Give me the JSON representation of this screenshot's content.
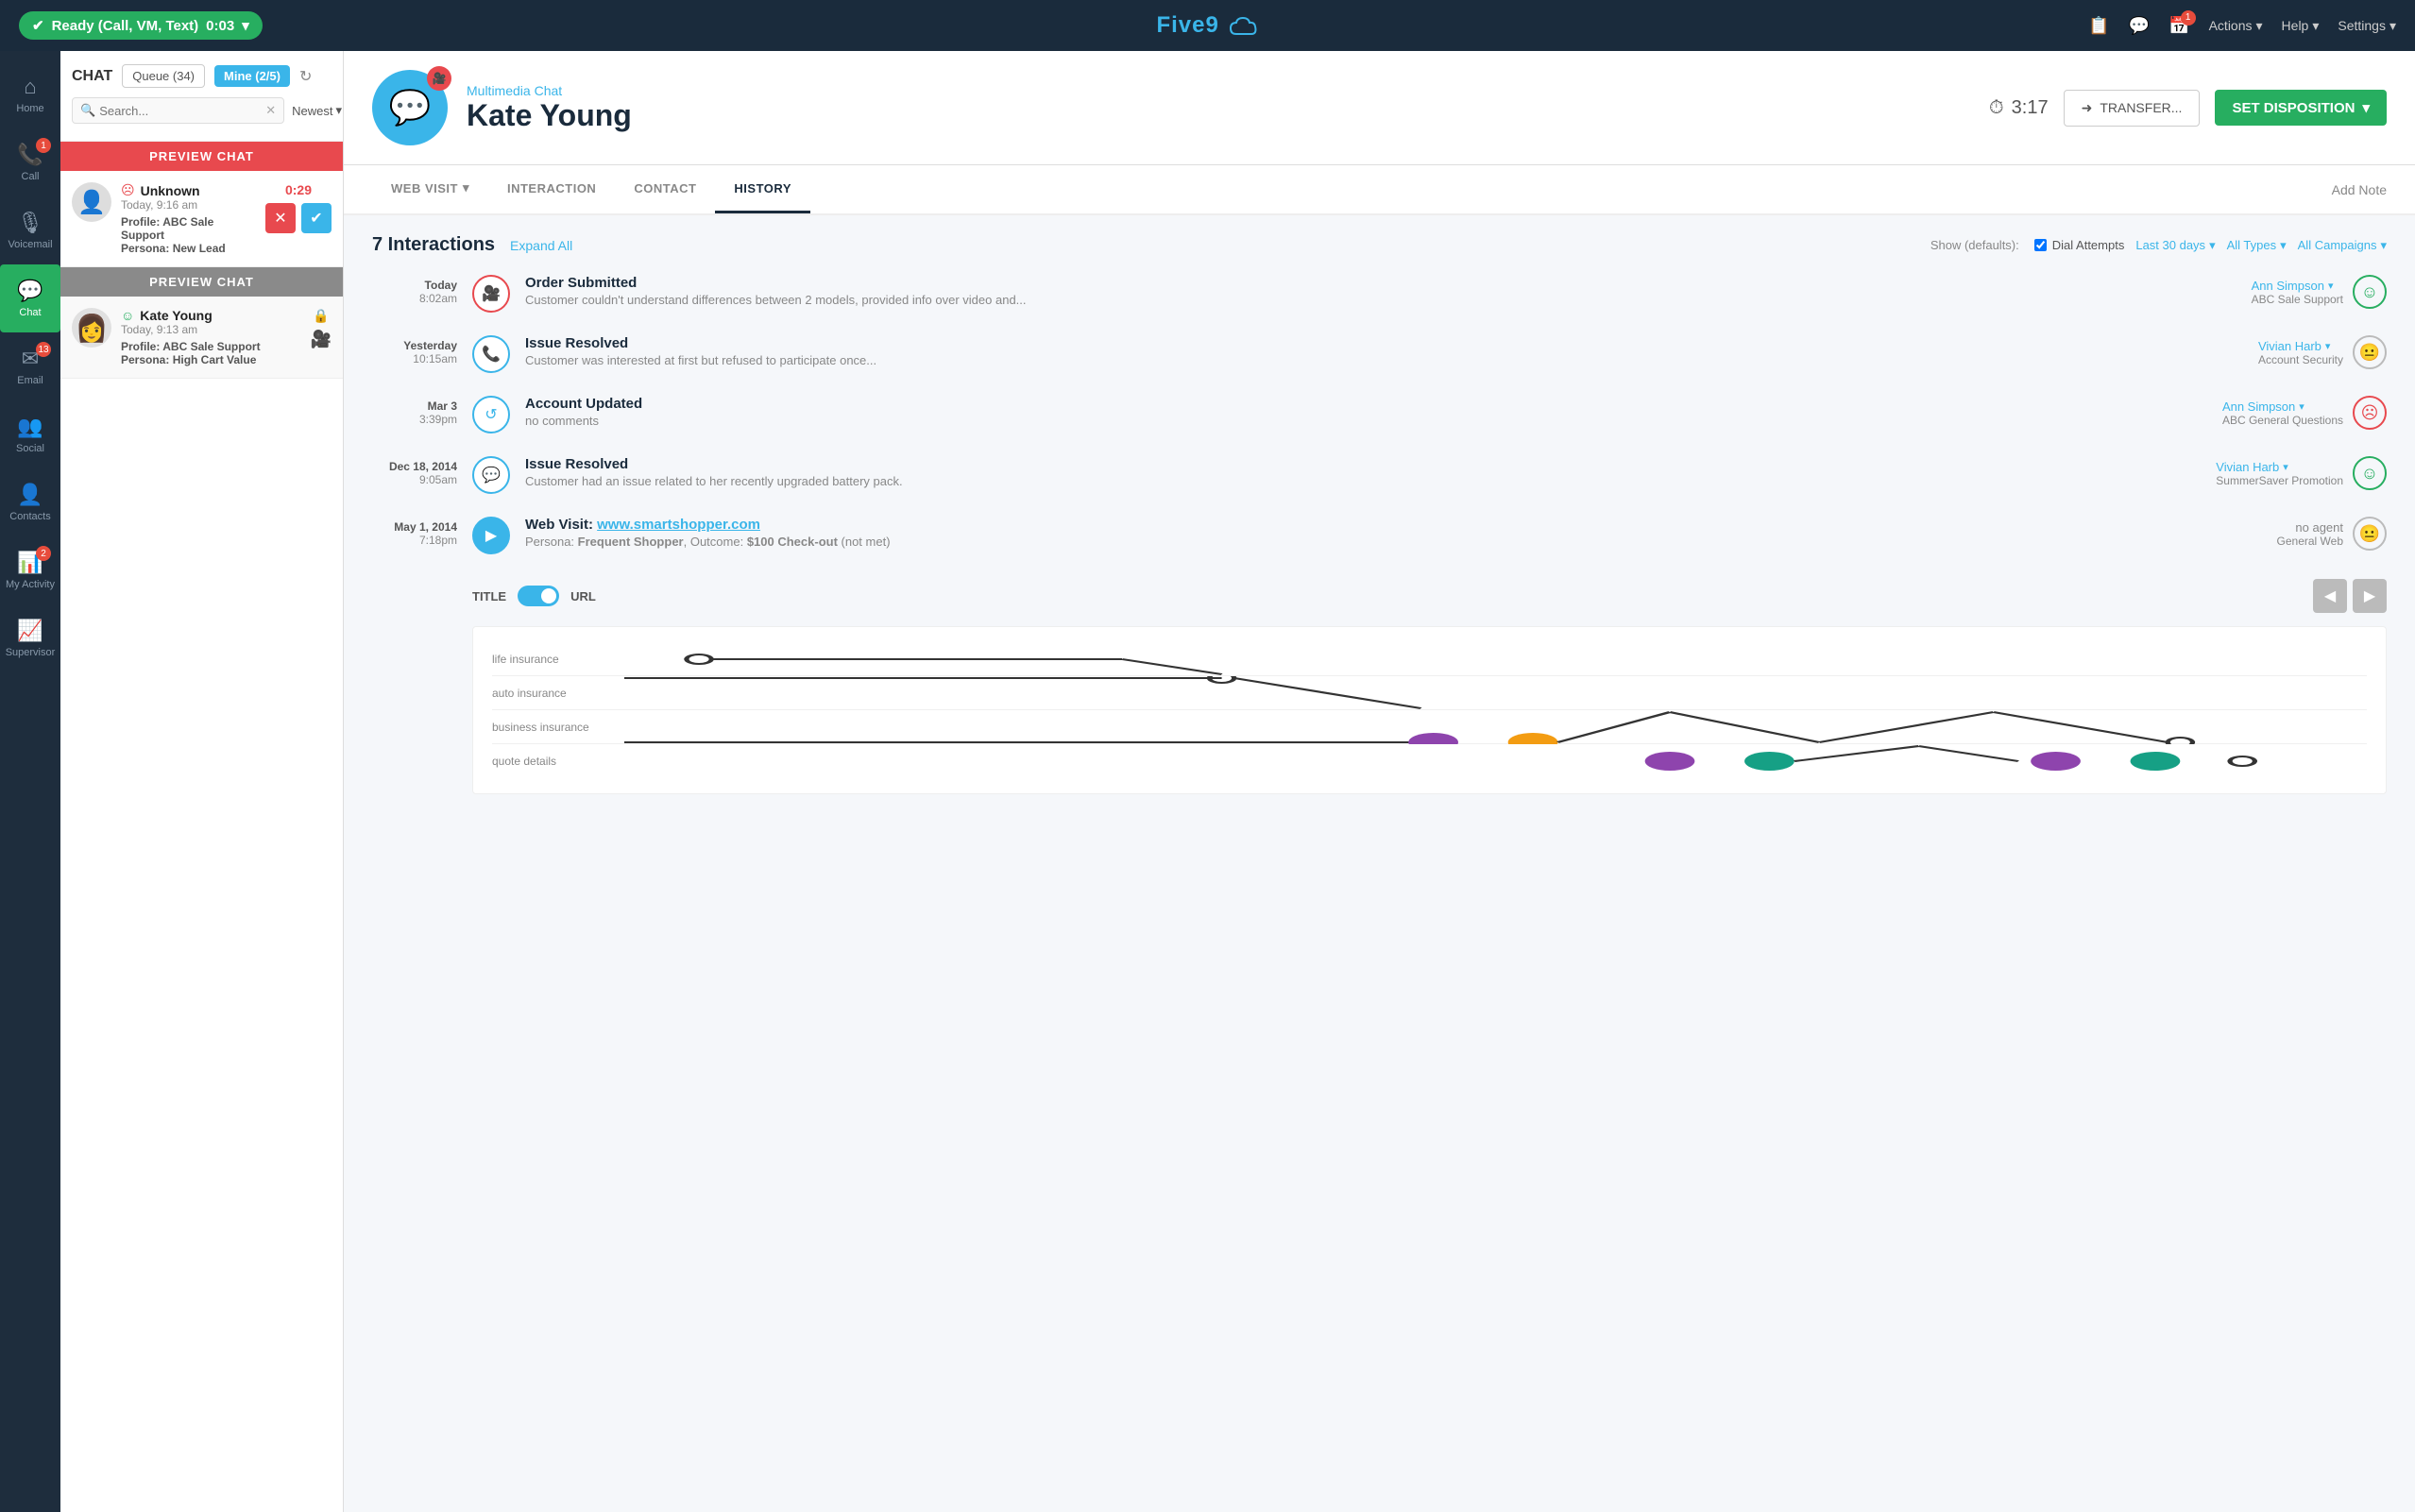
{
  "topNav": {
    "readyLabel": "Ready (Call, VM, Text)",
    "timer": "0:03",
    "logoText": "Five",
    "logoAccent": "9",
    "actionsLabel": "Actions",
    "helpLabel": "Help",
    "settingsLabel": "Settings",
    "notificationBadge": "1"
  },
  "sidebar": {
    "items": [
      {
        "id": "home",
        "label": "Home",
        "icon": "⌂",
        "badge": null,
        "active": false
      },
      {
        "id": "call",
        "label": "Call",
        "icon": "📞",
        "badge": "1",
        "active": false
      },
      {
        "id": "voicemail",
        "label": "Voicemail",
        "icon": "🎙",
        "badge": null,
        "active": false
      },
      {
        "id": "chat",
        "label": "Chat",
        "icon": "💬",
        "badge": null,
        "active": true
      },
      {
        "id": "email",
        "label": "Email",
        "icon": "✉",
        "badge": "13",
        "active": false
      },
      {
        "id": "social",
        "label": "Social",
        "icon": "👥",
        "badge": null,
        "active": false
      },
      {
        "id": "contacts",
        "label": "Contacts",
        "icon": "👤",
        "badge": null,
        "active": false
      },
      {
        "id": "my-activity",
        "label": "My Activity",
        "icon": "📊",
        "badge": "2",
        "active": false
      },
      {
        "id": "supervisor",
        "label": "Supervisor",
        "icon": "📈",
        "badge": null,
        "active": false
      }
    ]
  },
  "chatPanel": {
    "title": "CHAT",
    "queueLabel": "Queue (34)",
    "mineLabel": "Mine (2/5)",
    "searchPlaceholder": "Search...",
    "sortLabel": "Newest",
    "previewChats": [
      {
        "id": 1,
        "headerLabel": "PREVIEW CHAT",
        "headerColor": "red",
        "name": "Unknown",
        "time": "Today, 9:16 am",
        "profileLabel": "Profile:",
        "profileValue": "ABC Sale Support",
        "personaLabel": "Persona:",
        "personaValue": "New Lead",
        "hasTimer": true,
        "timerValue": "0:29",
        "showActions": true,
        "avatarType": "generic"
      },
      {
        "id": 2,
        "headerLabel": "PREVIEW CHAT",
        "headerColor": "gray",
        "name": "Kate Young",
        "time": "Today, 9:13 am",
        "profileLabel": "Profile:",
        "profileValue": "ABC Sale Support",
        "personaLabel": "Persona:",
        "personaValue": "High Cart Value",
        "hasTimer": false,
        "showActions": false,
        "avatarType": "photo"
      }
    ]
  },
  "contactHeader": {
    "subtitle": "Multimedia Chat",
    "name": "Kate Young",
    "timer": "3:17",
    "transferLabel": "TRANSFER...",
    "dispositionLabel": "SET DISPOSITION",
    "avatarIcon": "💬",
    "videoBadge": "🎥"
  },
  "tabs": [
    {
      "id": "web-visit",
      "label": "WEB VISIT",
      "active": false,
      "hasDropdown": true
    },
    {
      "id": "interaction",
      "label": "INTERACTION",
      "active": false
    },
    {
      "id": "contact",
      "label": "CONTACT",
      "active": false
    },
    {
      "id": "history",
      "label": "HISTORY",
      "active": true
    }
  ],
  "addNoteLabel": "Add Note",
  "history": {
    "interactionsCount": "7 Interactions",
    "expandAllLabel": "Expand All",
    "showLabel": "Show (defaults):",
    "dialAttemptsLabel": "Dial Attempts",
    "dialAttemptsChecked": true,
    "lastDaysLabel": "Last 30 days",
    "allTypesLabel": "All Types",
    "allCampaignsLabel": "All Campaigns",
    "interactions": [
      {
        "id": 1,
        "dateDay": "Today",
        "dateTime": "8:02am",
        "iconType": "video",
        "title": "Order Submitted",
        "description": "Customer couldn't understand differences between 2 models, provided info over video and...",
        "agentName": "Ann Simpson",
        "agentHasDropdown": true,
        "campaign": "ABC Sale Support",
        "sentiment": "happy"
      },
      {
        "id": 2,
        "dateDay": "Yesterday",
        "dateTime": "10:15am",
        "iconType": "phone",
        "title": "Issue Resolved",
        "description": "Customer was interested at first but refused to participate once...",
        "agentName": "Vivian Harb",
        "agentHasDropdown": true,
        "campaign": "Account Security",
        "sentiment": "neutral"
      },
      {
        "id": 3,
        "dateDay": "Mar 3",
        "dateTime": "3:39pm",
        "iconType": "transfer",
        "title": "Account Updated",
        "description": "no comments",
        "agentName": "Ann Simpson",
        "agentHasDropdown": true,
        "campaign": "ABC General Questions",
        "sentiment": "sad"
      },
      {
        "id": 4,
        "dateDay": "Dec 18, 2014",
        "dateTime": "9:05am",
        "iconType": "chat",
        "title": "Issue Resolved",
        "description": "Customer had an issue related to her recently upgraded battery pack.",
        "agentName": "Vivian Harb",
        "agentHasDropdown": true,
        "campaign": "SummerSaver Promotion",
        "sentiment": "happy"
      },
      {
        "id": 5,
        "dateDay": "May 1, 2014",
        "dateTime": "7:18pm",
        "iconType": "webvisit",
        "title": "Web Visit:",
        "titleLink": "www.smartshopper.com",
        "description": "Persona: Frequent Shopper, Outcome: $100 Check-out (not met)",
        "agentName": "no agent",
        "agentHasDropdown": false,
        "campaign": "General Web",
        "sentiment": "neutral",
        "expanded": true
      }
    ],
    "webVisit": {
      "toggleLabelLeft": "TITLE",
      "toggleLabelRight": "URL",
      "journeyRows": [
        {
          "label": "life insurance",
          "lineStart": 0,
          "lineEnd": 35
        },
        {
          "label": "auto insurance",
          "lineStart": 35,
          "lineEnd": 55
        },
        {
          "label": "business insurance",
          "lineStart": 55,
          "lineEnd": 80
        },
        {
          "label": "quote details",
          "lineStart": 55,
          "lineEnd": 100
        }
      ]
    }
  }
}
